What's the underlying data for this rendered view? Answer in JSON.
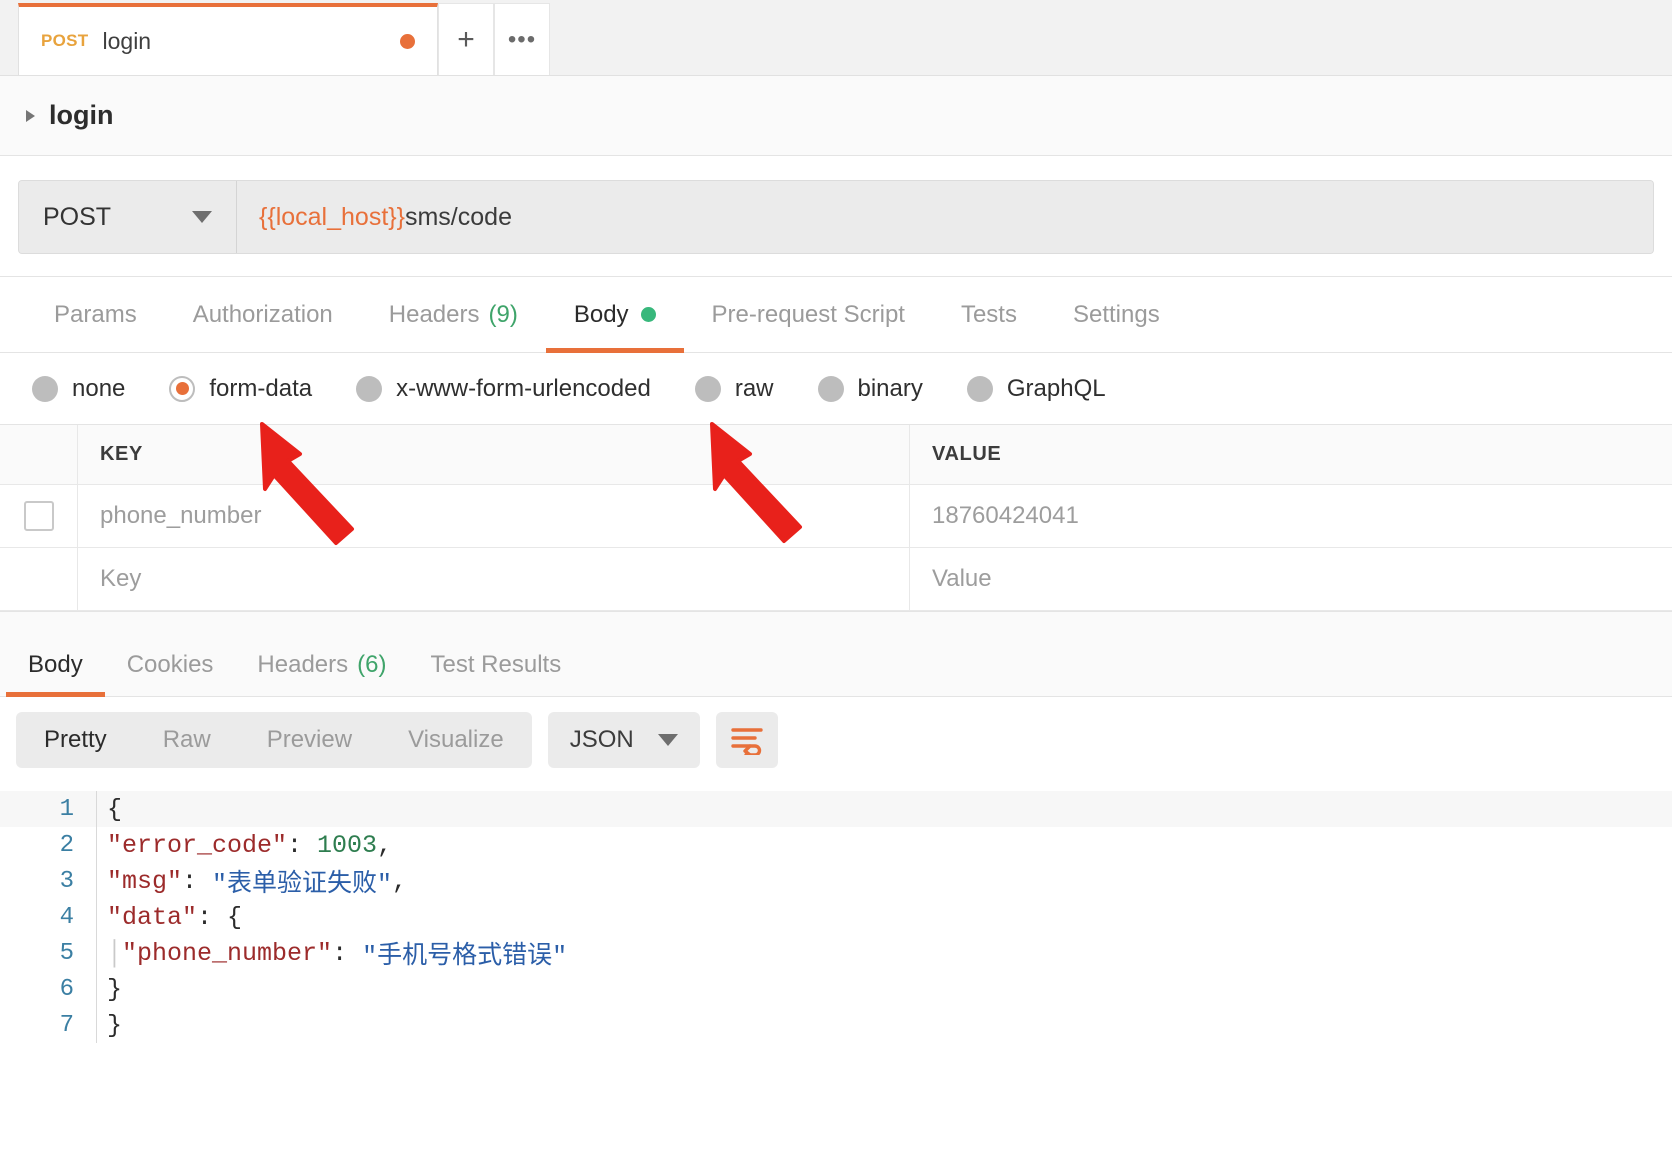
{
  "tabstrip": {
    "request_tab": {
      "method": "POST",
      "name": "login",
      "unsaved": true
    },
    "new_tab_label": "+",
    "more_label": "•••"
  },
  "breadcrumb": {
    "title": "login"
  },
  "url_bar": {
    "method": "POST",
    "url_variable": "{{local_host}}",
    "url_path": "sms/code"
  },
  "request_tabs": [
    {
      "label": "Params",
      "active": false
    },
    {
      "label": "Authorization",
      "active": false
    },
    {
      "label": "Headers",
      "count": "(9)",
      "active": false
    },
    {
      "label": "Body",
      "active": true,
      "dot": true
    },
    {
      "label": "Pre-request Script",
      "active": false
    },
    {
      "label": "Tests",
      "active": false
    },
    {
      "label": "Settings",
      "active": false
    }
  ],
  "body_types": [
    {
      "label": "none",
      "selected": false
    },
    {
      "label": "form-data",
      "selected": true
    },
    {
      "label": "x-www-form-urlencoded",
      "selected": false
    },
    {
      "label": "raw",
      "selected": false
    },
    {
      "label": "binary",
      "selected": false
    },
    {
      "label": "GraphQL",
      "selected": false
    }
  ],
  "kv_table": {
    "headers": {
      "key": "KEY",
      "value": "VALUE"
    },
    "rows": [
      {
        "key": "phone_number",
        "value": "18760424041",
        "checked": false
      },
      {
        "key": "Key",
        "value": "Value",
        "placeholder": true
      }
    ]
  },
  "response_tabs": [
    {
      "label": "Body",
      "active": true
    },
    {
      "label": "Cookies",
      "active": false
    },
    {
      "label": "Headers",
      "count": "(6)",
      "active": false
    },
    {
      "label": "Test Results",
      "active": false
    }
  ],
  "format_toolbar": {
    "segments": [
      {
        "label": "Pretty",
        "active": true
      },
      {
        "label": "Raw",
        "active": false
      },
      {
        "label": "Preview",
        "active": false
      },
      {
        "label": "Visualize",
        "active": false
      }
    ],
    "format_select": "JSON",
    "wrap_icon": "word-wrap-icon"
  },
  "response_body": {
    "language": "json",
    "lines": [
      {
        "n": "1",
        "text": "{"
      },
      {
        "n": "2",
        "text": "    \"error_code\": 1003,"
      },
      {
        "n": "3",
        "text": "    \"msg\": \"表单验证失败\","
      },
      {
        "n": "4",
        "text": "    \"data\": {"
      },
      {
        "n": "5",
        "text": "        \"phone_number\": \"手机号格式错误\""
      },
      {
        "n": "6",
        "text": "    }"
      },
      {
        "n": "7",
        "text": "}"
      }
    ],
    "parsed": {
      "error_code": 1003,
      "msg": "表单验证失败",
      "data": {
        "phone_number": "手机号格式错误"
      }
    }
  },
  "annotations": {
    "arrow_color": "#e8211b",
    "arrows": [
      {
        "name": "arrow-to-form-data",
        "points_to": "form-data"
      },
      {
        "name": "arrow-to-raw",
        "points_to": "raw"
      }
    ]
  },
  "colors": {
    "accent_orange": "#e8703a",
    "method_orange": "#e8a33d",
    "green": "#38b87c",
    "arrow_red": "#e8211b"
  }
}
